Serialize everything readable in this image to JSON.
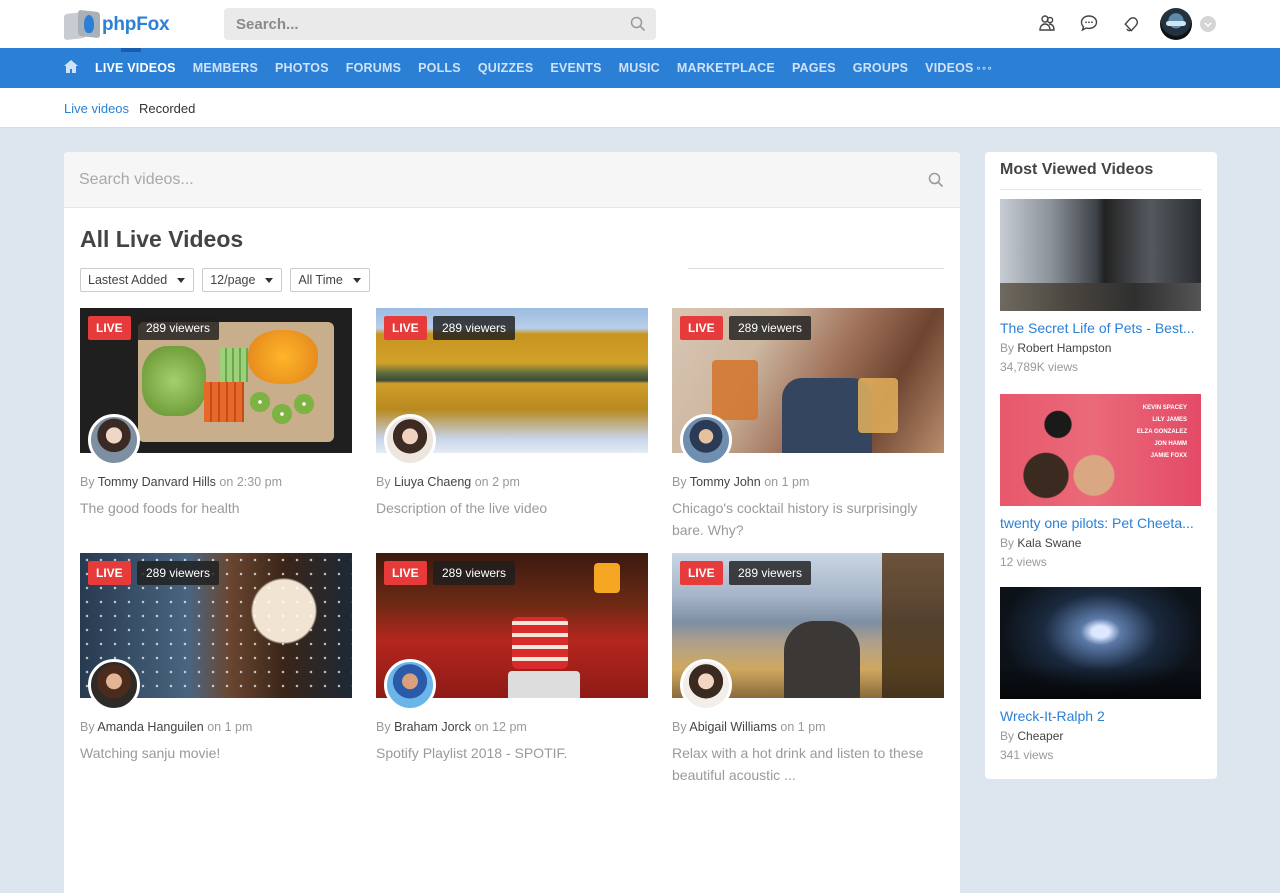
{
  "header": {
    "logo_text": "phpFox",
    "search_placeholder": "Search..."
  },
  "nav": {
    "items": [
      "LIVE VIDEOS",
      "MEMBERS",
      "PHOTOS",
      "FORUMS",
      "POLLS",
      "QUIZZES",
      "EVENTS",
      "MUSIC",
      "MARKETPLACE",
      "PAGES",
      "GROUPS",
      "VIDEOS"
    ],
    "more_dots": "∘∘∘"
  },
  "subnav": {
    "live": "Live videos",
    "recorded": "Recorded"
  },
  "main": {
    "search_placeholder": "Search videos...",
    "title": "All Live Videos",
    "filters": [
      "Lastest Added",
      "12/page",
      "All Time"
    ],
    "by": "By",
    "on": "on",
    "live_badge": "LIVE",
    "videos": [
      {
        "viewers": "289 viewers",
        "author": "Tommy Danvard Hills",
        "time": "2:30 pm",
        "desc": "The good foods for health"
      },
      {
        "viewers": "289 viewers",
        "author": "Liuya Chaeng",
        "time": "2 pm",
        "desc": "Description of the live video"
      },
      {
        "viewers": "289 viewers",
        "author": "Tommy John",
        "time": "1 pm",
        "desc": "Chicago's cocktail history is surprisingly bare. Why?"
      },
      {
        "viewers": "289 viewers",
        "author": "Amanda Hanguilen",
        "time": "1 pm",
        "desc": "Watching sanju movie!"
      },
      {
        "viewers": "289 viewers",
        "author": "Braham Jorck",
        "time": "12 pm",
        "desc": "Spotify Playlist 2018 - SPOTIF."
      },
      {
        "viewers": "289 viewers",
        "author": "Abigail Williams",
        "time": "1 pm",
        "desc": "Relax with a hot drink and listen to these beautiful acoustic ..."
      }
    ]
  },
  "sidebar": {
    "title": "Most Viewed Videos",
    "by": "By",
    "items": [
      {
        "title": "The Secret Life of Pets - Best...",
        "author": "Robert Hampston",
        "views": "34,789K views"
      },
      {
        "title": "twenty one pilots: Pet Cheeta...",
        "author": "Kala Swane",
        "views": "12 views"
      },
      {
        "title": "Wreck-It-Ralph 2",
        "author": "Cheaper",
        "views": "341 views"
      }
    ],
    "poster_credits": [
      "KEVIN SPACEY",
      "LILY JAMES",
      "ELZA GONZALEZ",
      "JON HAMM",
      "JAMIE FOXX"
    ]
  },
  "colors": {
    "brand": "#2b80d6",
    "live": "#e73a3a",
    "page_bg": "#dde6ef"
  }
}
